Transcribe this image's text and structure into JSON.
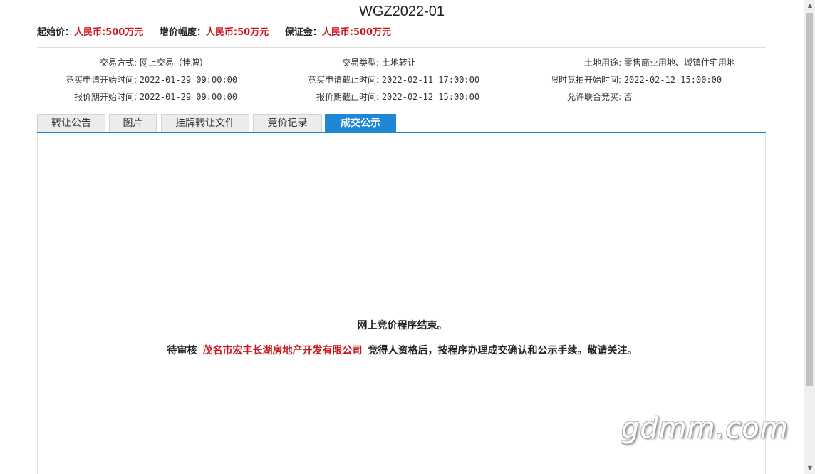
{
  "title": "WGZ2022-01",
  "prices": {
    "start_label": "起始价：",
    "start_value": "人民币:500万元",
    "increment_label": "增价幅度：",
    "increment_value": "人民币:50万元",
    "deposit_label": "保证金：",
    "deposit_value": "人民币:500万元"
  },
  "info": {
    "trade_method_label": "交易方式:",
    "trade_method_value": "网上交易（挂牌）",
    "trade_type_label": "交易类型:",
    "trade_type_value": "土地转让",
    "land_use_label": "土地用途:",
    "land_use_value": "零售商业用地、城镇住宅用地",
    "apply_start_label": "竞买申请开始时间:",
    "apply_start_value": "2022-01-29 09:00:00",
    "apply_end_label": "竞买申请截止时间:",
    "apply_end_value": "2022-02-11 17:00:00",
    "auction_start_label": "限时竞拍开始时间:",
    "auction_start_value": "2022-02-12 15:00:00",
    "quote_start_label": "报价期开始时间:",
    "quote_start_value": "2022-01-29 09:00:00",
    "quote_end_label": "报价期截止时间:",
    "quote_end_value": "2022-02-12 15:00:00",
    "joint_label": "允许联合竞买:",
    "joint_value": "否"
  },
  "tabs": [
    "转让公告",
    "图片",
    "挂牌转让文件",
    "竞价记录",
    "成交公示"
  ],
  "active_tab": "成交公示",
  "content": {
    "line1": "网上竞价程序结束。",
    "line2_prefix": "待审核",
    "company": "茂名市宏丰长湖房地产开发有限公司",
    "line2_suffix": "竞得人资格后，按程序办理成交确认和公示手续。敬请关注。"
  },
  "watermark": "gdmm.com",
  "colors": {
    "accent": "#1e88d6",
    "price_red": "#c8161d"
  }
}
